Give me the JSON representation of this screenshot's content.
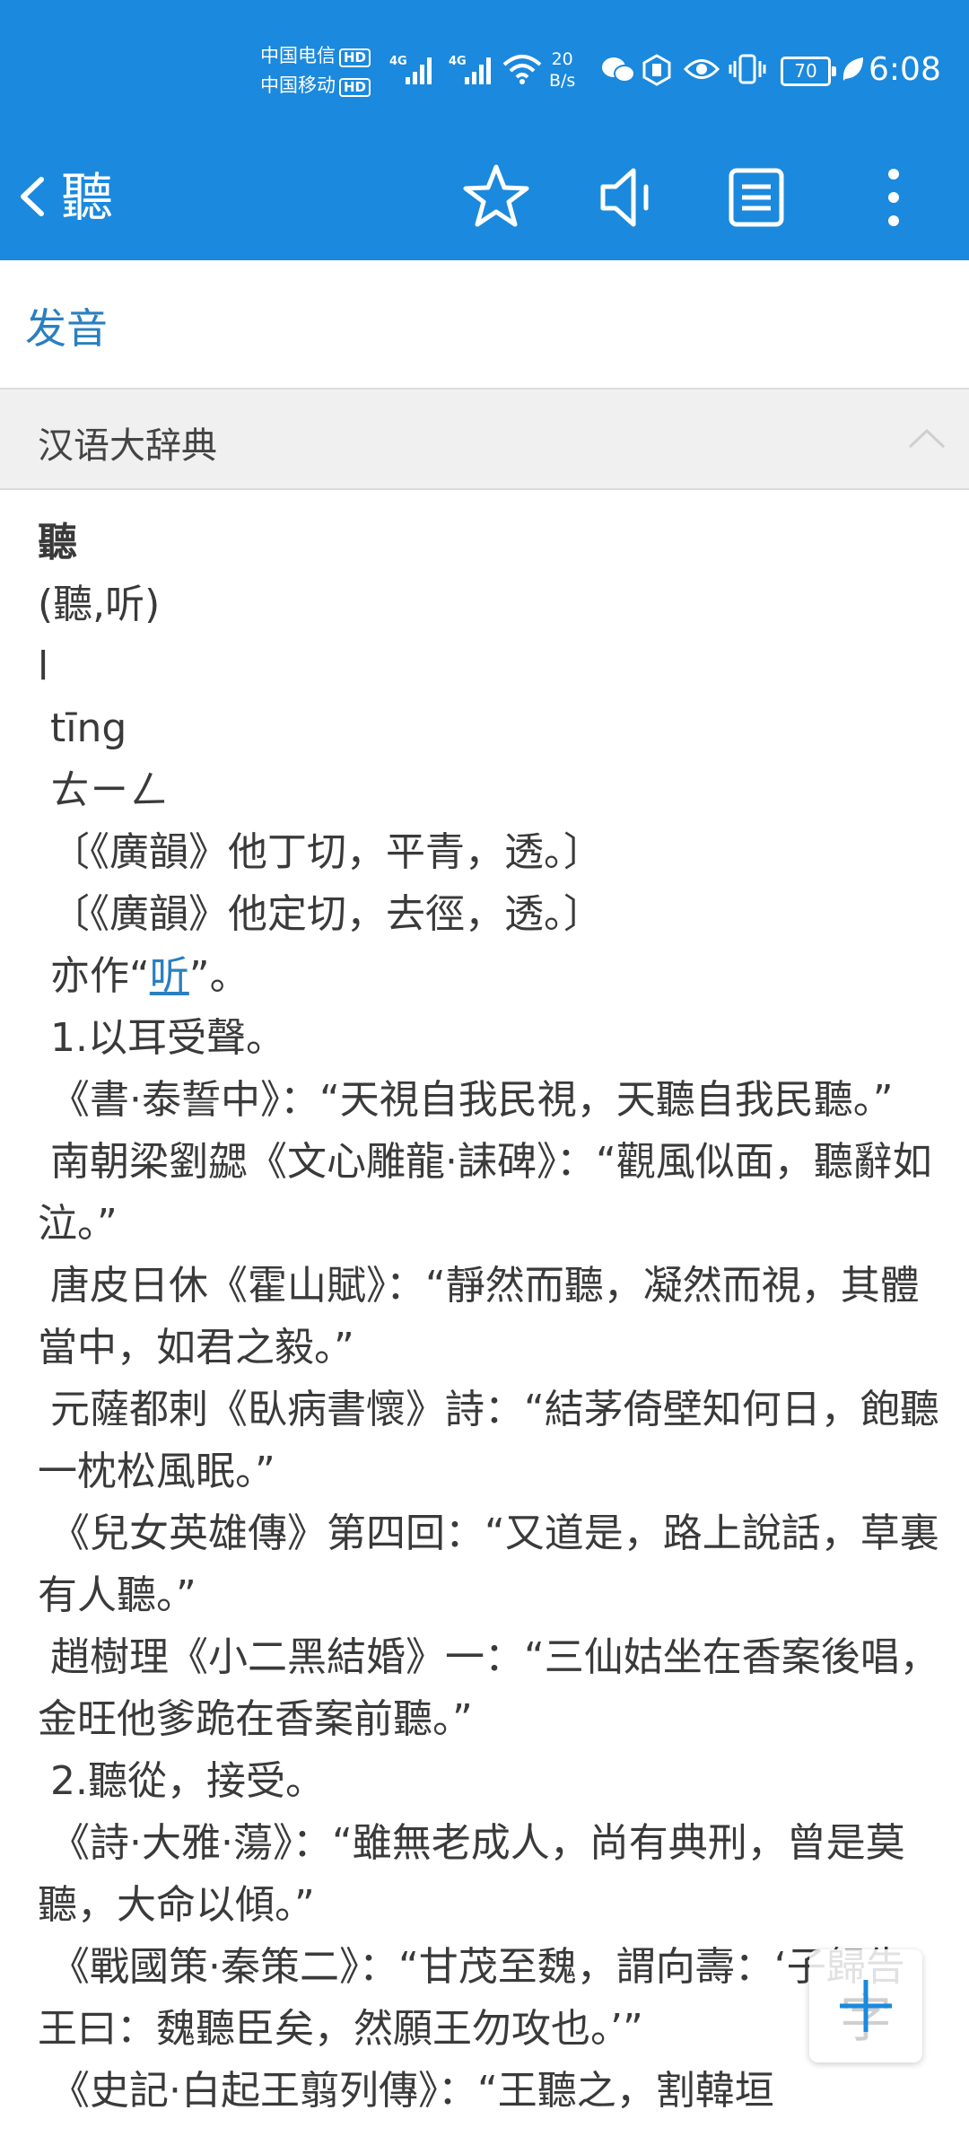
{
  "status_bar": {
    "carrier_1": "中国电信",
    "carrier_2": "中国移动",
    "hd_label": "HD",
    "network_type": "4G",
    "speed_value": "20",
    "speed_unit": "B/s",
    "battery": "70",
    "time": "6:08"
  },
  "app_bar": {
    "title": "聽",
    "icons": [
      "back-icon",
      "star-icon",
      "speaker-icon",
      "list-icon",
      "more-icon"
    ]
  },
  "pronunciation_link": "发音",
  "dictionary_section": {
    "name": "汉语大辞典"
  },
  "entry": {
    "headword": "聽",
    "variants": "(聽,听)",
    "line3": "l",
    "pinyin": " tīng",
    "zhuyin": " ㄊㄧㄥ",
    "fanqie_1": " 〔《廣韻》他丁切，平青，透。〕",
    "fanqie_2": " 〔《廣韻》他定切，去徑，透。〕",
    "also_prefix": " 亦作“",
    "also_link": "听",
    "also_suffix": "”。",
    "paragraphs": [
      " 1.以耳受聲。",
      " 《書·泰誓中》：“天視自我民視，天聽自我民聽。”",
      " 南朝梁劉勰《文心雕龍·誄碑》：“觀風似面，聽辭如泣。”",
      " 唐皮日休《霍山賦》：“靜然而聽，凝然而視，其體當中，如君之毅。”",
      " 元薩都剌《臥病書懷》詩：“結茅倚壁知何日，飽聽一枕松風眠。”",
      " 《兒女英雄傳》第四回：“又道是，路上說話，草裏有人聽。”",
      " 趙樹理《小二黑結婚》一：“三仙姑坐在香案後唱，金旺他爹跪在香案前聽。”",
      " 2.聽從，接受。",
      " 《詩·大雅·蕩》：“雖無老成人，尚有典刑，曾是莫聽，大命以傾。”",
      " 《戰國策·秦策二》：“甘茂至魏，謂向壽：‘子歸告王曰：魏聽臣矣，然願王勿攻也。’”",
      " 《史記·白起王翦列傳》：“王聽之，割韓垣"
    ]
  },
  "fab": {
    "glyph": "字"
  },
  "colors": {
    "primary": "#1b89dd",
    "link": "#2a7fc0",
    "section_bg": "#f0f0f0"
  }
}
